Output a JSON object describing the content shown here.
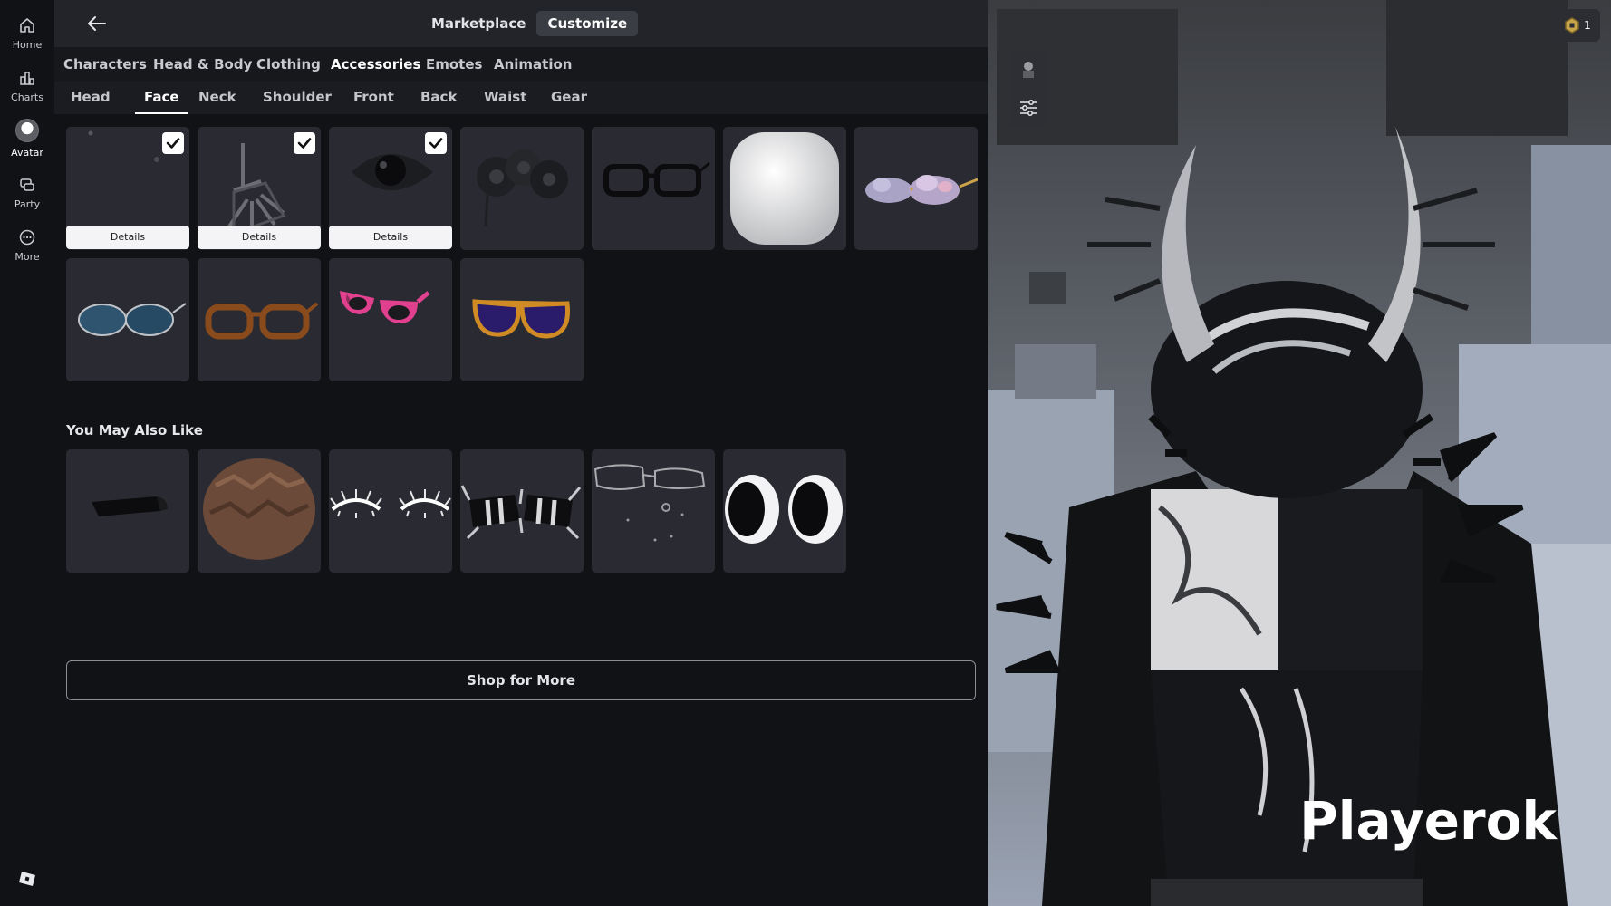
{
  "rail": {
    "items": [
      {
        "label": "Home",
        "icon": "home-icon"
      },
      {
        "label": "Charts",
        "icon": "charts-icon"
      },
      {
        "label": "Avatar",
        "icon": "avatar-icon"
      },
      {
        "label": "Party",
        "icon": "party-icon"
      },
      {
        "label": "More",
        "icon": "more-icon"
      }
    ],
    "active": "Avatar"
  },
  "header": {
    "back_icon": "back-arrow-icon",
    "tabs": [
      "Marketplace",
      "Customize"
    ],
    "active_tab": "Customize"
  },
  "categories": [
    "Characters",
    "Head & Body",
    "Clothing",
    "Accessories",
    "Emotes",
    "Animation"
  ],
  "active_category": "Accessories",
  "subcategories": [
    "Head",
    "Face",
    "Neck",
    "Shoulder",
    "Front",
    "Back",
    "Waist",
    "Gear"
  ],
  "active_subcategory": "Face",
  "owned_items": {
    "details_label": "Details",
    "items": [
      {
        "name": "tiny dots face accessory",
        "equipped": true
      },
      {
        "name": "skeleton hand accessory",
        "equipped": true
      },
      {
        "name": "dark eye accessory",
        "equipped": true
      },
      {
        "name": "black flower crown",
        "equipped": false
      },
      {
        "name": "black rim glasses",
        "equipped": false
      },
      {
        "name": "white blank mask",
        "equipped": false
      },
      {
        "name": "iridescent cloud glasses",
        "equipped": false
      },
      {
        "name": "blue aviator sunglasses",
        "equipped": false
      },
      {
        "name": "brown glasses",
        "equipped": false
      },
      {
        "name": "pink sunglasses",
        "equipped": false
      },
      {
        "name": "purple gold sunglasses",
        "equipped": false
      }
    ]
  },
  "recommendations": {
    "title": "You May Also Like",
    "items": [
      {
        "name": "black shades"
      },
      {
        "name": "brown messy hair"
      },
      {
        "name": "spiky lashes"
      },
      {
        "name": "spiked black mask"
      },
      {
        "name": "silver wire glasses"
      },
      {
        "name": "big round eyes"
      }
    ]
  },
  "shop_button": "Shop for More",
  "viewport": {
    "player_name": "Playerok",
    "robux_count": "1",
    "robux_icon": "robux-icon",
    "controls": [
      "avatar-thumb-icon",
      "sliders-icon"
    ]
  },
  "colors": {
    "background": "#111216",
    "tile": "#2a2b32",
    "scene": "#707784"
  }
}
